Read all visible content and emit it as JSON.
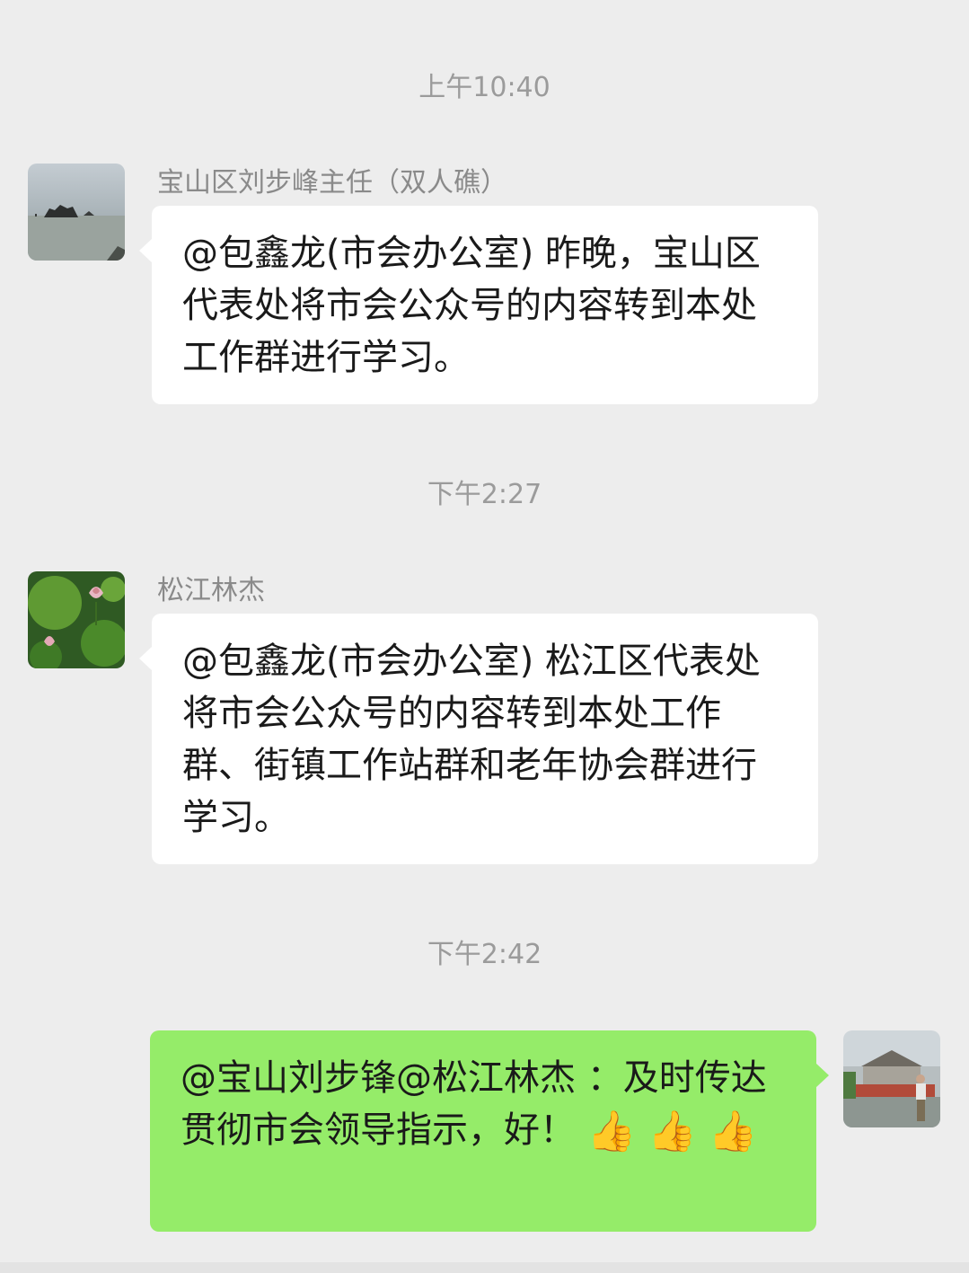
{
  "chat": {
    "messages": [
      {
        "time": "上午10:40",
        "sender": "宝山区刘步峰主任（双人礁）",
        "avatar_icon": "sea-rocks-avatar-icon",
        "text": "@包鑫龙(市会办公室) 昨晚，宝山区代表处将市会公众号的内容转到本处工作群进行学习。",
        "direction": "incoming"
      },
      {
        "time": "下午2:27",
        "sender": "松江林杰",
        "avatar_icon": "lotus-avatar-icon",
        "text": "@包鑫龙(市会办公室) 松江区代表处将市会公众号的内容转到本处工作群、街镇工作站群和老年协会群进行学习。",
        "direction": "incoming"
      },
      {
        "time": "下午2:42",
        "avatar_icon": "building-avatar-icon",
        "text": "@宝山刘步锋@松江林杰 ：及时传达贯彻市会领导指示，好！",
        "emoji": [
          "thumbs-up-icon",
          "thumbs-up-icon",
          "thumbs-up-icon"
        ],
        "direction": "outgoing"
      }
    ]
  },
  "colors": {
    "background": "#ededed",
    "incoming_bubble": "#ffffff",
    "outgoing_bubble": "#95ec69",
    "timestamp_text": "#9b9b9b",
    "sender_text": "#8a8a8a"
  }
}
